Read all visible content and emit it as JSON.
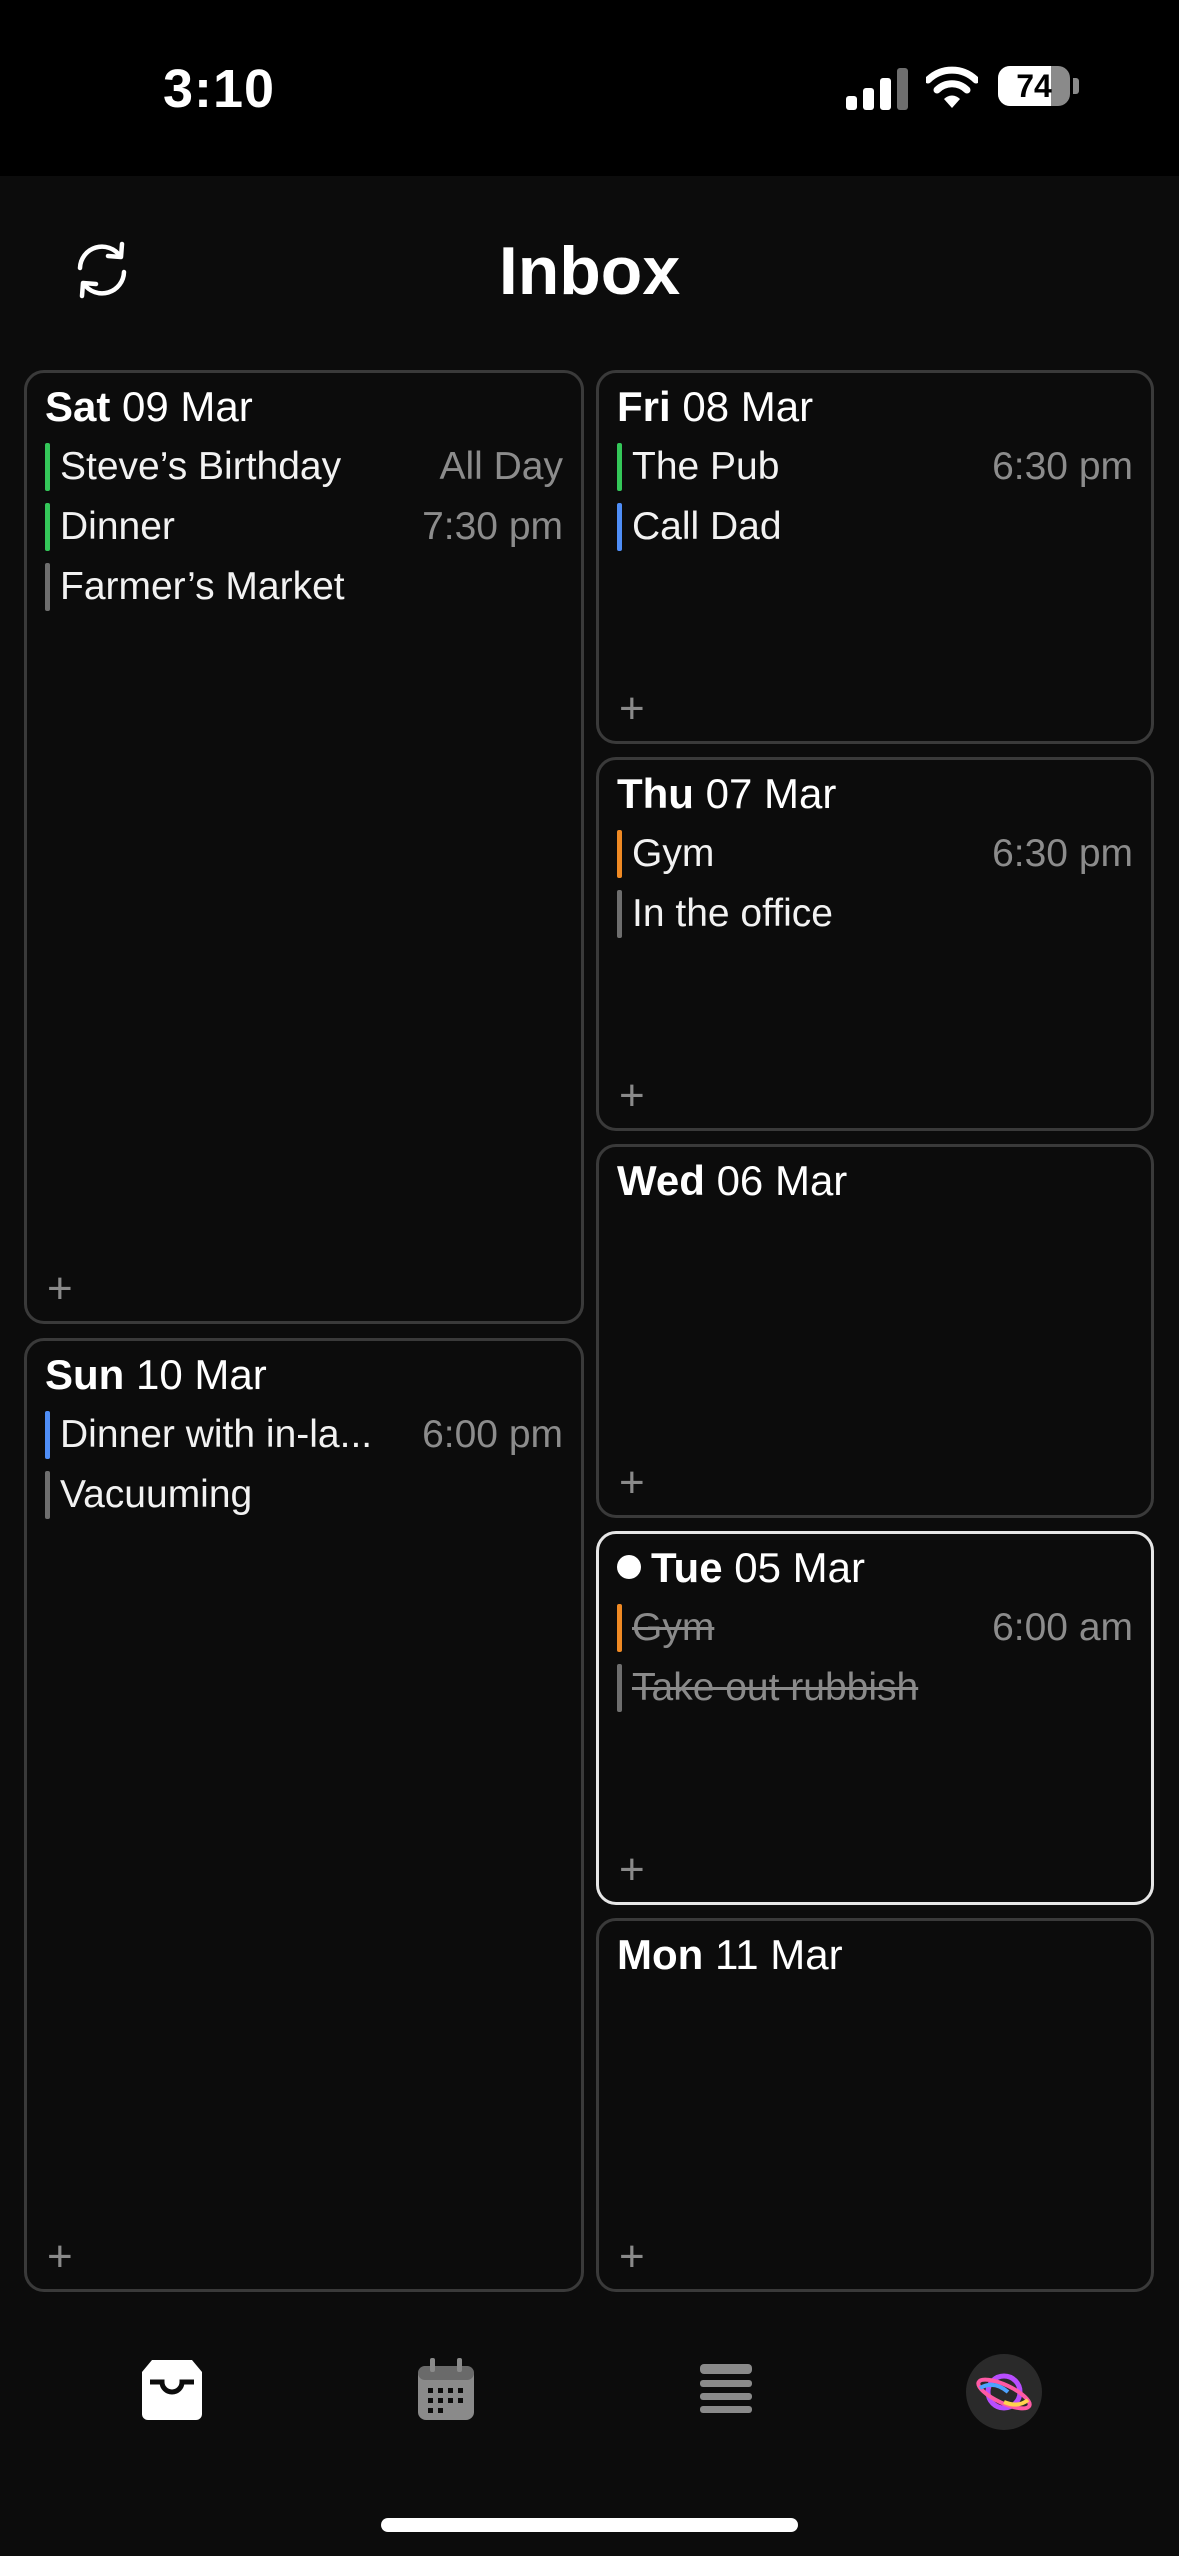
{
  "status": {
    "time": "3:10",
    "battery": "74",
    "battery_level": 0.74
  },
  "header": {
    "title": "Inbox",
    "refresh_icon": "refresh-icon"
  },
  "colors": {
    "green": "#34c759",
    "blue": "#4f8ef7",
    "orange": "#f08a24",
    "gray": "#6e6e6e"
  },
  "cards": {
    "sat": {
      "dow": "Sat",
      "date": "09 Mar",
      "events": [
        {
          "title": "Steve’s Birthday",
          "time": "All Day",
          "color": "#34c759"
        },
        {
          "title": "Dinner",
          "time": "7:30 pm",
          "color": "#34c759"
        },
        {
          "title": "Farmer’s Market",
          "time": "",
          "color": "#6e6e6e"
        }
      ]
    },
    "sun": {
      "dow": "Sun",
      "date": "10 Mar",
      "events": [
        {
          "title": "Dinner with in-la...",
          "time": "6:00 pm",
          "color": "#4f8ef7"
        },
        {
          "title": "Vacuuming",
          "time": "",
          "color": "#6e6e6e"
        }
      ]
    },
    "fri": {
      "dow": "Fri",
      "date": "08 Mar",
      "events": [
        {
          "title": "The Pub",
          "time": "6:30 pm",
          "color": "#34c759"
        },
        {
          "title": "Call Dad",
          "time": "",
          "color": "#4f8ef7"
        }
      ]
    },
    "thu": {
      "dow": "Thu",
      "date": "07 Mar",
      "events": [
        {
          "title": "Gym",
          "time": "6:30 pm",
          "color": "#f08a24"
        },
        {
          "title": "In the office",
          "time": "",
          "color": "#6e6e6e"
        }
      ]
    },
    "wed": {
      "dow": "Wed",
      "date": "06 Mar",
      "events": []
    },
    "tue": {
      "dow": "Tue",
      "date": "05 Mar",
      "today": true,
      "events": [
        {
          "title": "Gym",
          "time": "6:00 am",
          "color": "#f08a24",
          "done": true
        },
        {
          "title": "Take out rubbish",
          "time": "",
          "color": "#6e6e6e",
          "done": true
        }
      ]
    },
    "mon": {
      "dow": "Mon",
      "date": "11 Mar",
      "events": []
    }
  },
  "add_symbol": "+",
  "tabs": [
    {
      "name": "inbox",
      "icon": "inbox-tray-icon",
      "active": true
    },
    {
      "name": "calendar",
      "icon": "calendar-icon",
      "active": false
    },
    {
      "name": "list",
      "icon": "stacked-list-icon",
      "active": false
    },
    {
      "name": "assistant",
      "icon": "orb-planet-icon",
      "active": false
    }
  ]
}
